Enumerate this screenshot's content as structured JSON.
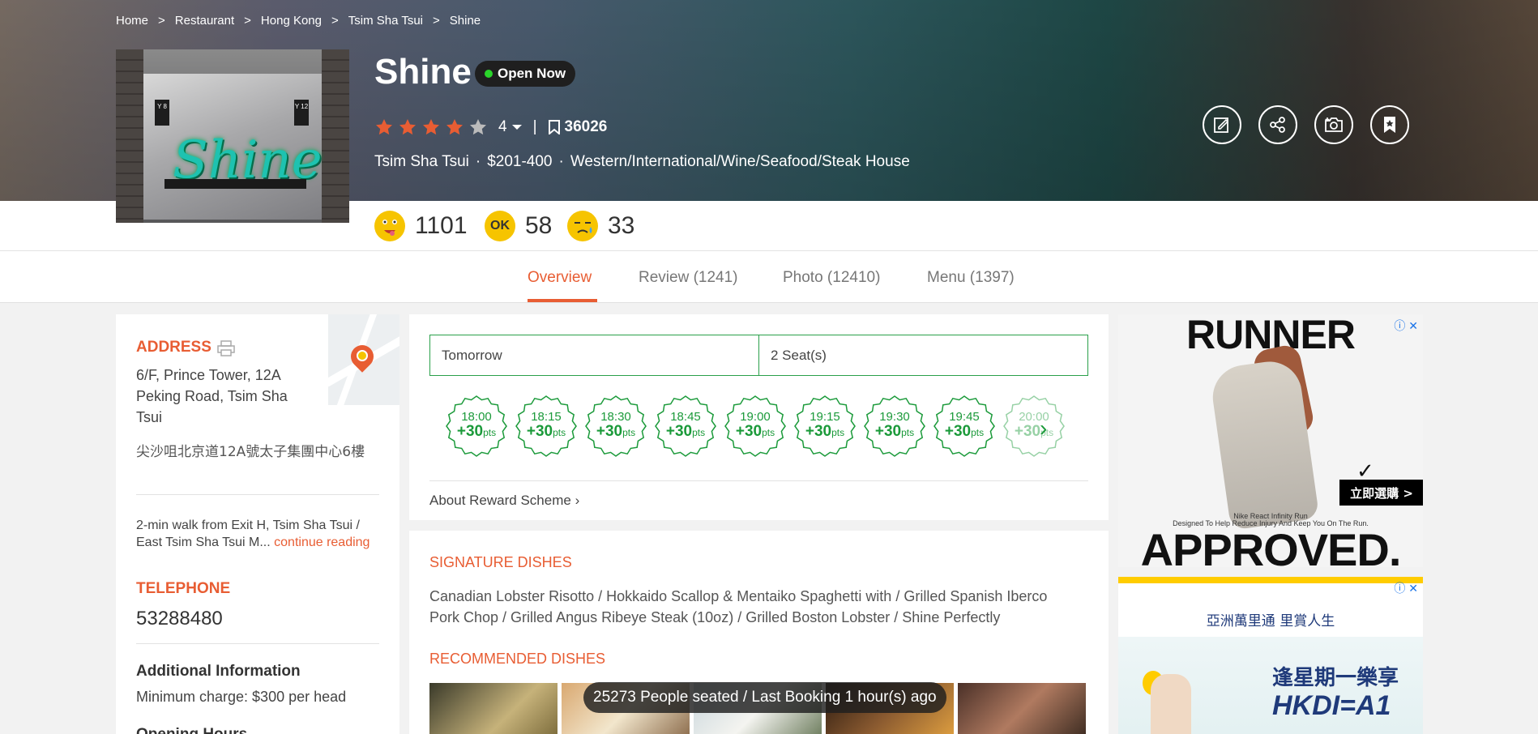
{
  "breadcrumb": [
    "Home",
    "Restaurant",
    "Hong Kong",
    "Tsim Sha Tsui",
    "Shine"
  ],
  "restaurant": {
    "name": "Shine",
    "status": "Open Now",
    "rating_stars": 4,
    "rating_display": "4",
    "bookmarks": "36026",
    "district": "Tsim Sha Tsui",
    "price": "$201-400",
    "cuisine": "Western/International/Wine/Seafood/Steak House",
    "thumb_sign": "Shine",
    "thumb_tag_left": "Y 8",
    "thumb_tag_right": "Y 12"
  },
  "reactions": {
    "smile": "1101",
    "ok": "58",
    "cry": "33",
    "ok_face": "OK"
  },
  "tabs": [
    {
      "label": "Overview",
      "active": true
    },
    {
      "label": "Review (1241)",
      "active": false
    },
    {
      "label": "Photo (12410)",
      "active": false
    },
    {
      "label": "Menu (1397)",
      "active": false
    }
  ],
  "sidebar": {
    "address_label": "ADDRESS",
    "address_en": "6/F, Prince Tower, 12A Peking Road, Tsim Sha Tsui",
    "address_zh": "尖沙咀北京道12A號太子集團中心6樓",
    "directions": "2-min walk from Exit H, Tsim Sha Tsui / East Tsim Sha Tsui M...",
    "continue": "continue reading",
    "telephone_label": "TELEPHONE",
    "telephone": "53288480",
    "additional_label": "Additional Information",
    "additional_text": "Minimum charge: $300 per head",
    "opening_label": "Opening Hours"
  },
  "booking": {
    "date": "Tomorrow",
    "seats": "2 Seat(s)",
    "slots": [
      {
        "time": "18:00",
        "pts": "+30",
        "unit": "pts"
      },
      {
        "time": "18:15",
        "pts": "+30",
        "unit": "pts"
      },
      {
        "time": "18:30",
        "pts": "+30",
        "unit": "pts"
      },
      {
        "time": "18:45",
        "pts": "+30",
        "unit": "pts"
      },
      {
        "time": "19:00",
        "pts": "+30",
        "unit": "pts"
      },
      {
        "time": "19:15",
        "pts": "+30",
        "unit": "pts"
      },
      {
        "time": "19:30",
        "pts": "+30",
        "unit": "pts"
      },
      {
        "time": "19:45",
        "pts": "+30",
        "unit": "pts"
      },
      {
        "time": "20:00",
        "pts": "+30",
        "unit": "pts"
      }
    ],
    "reward": "About Reward Scheme"
  },
  "signature": {
    "label": "SIGNATURE DISHES",
    "text": "Canadian Lobster Risotto / Hokkaido Scallop & Mentaiko Spaghetti with / Grilled Spanish Iberco Pork Chop / Grilled Angus Ribeye Steak (10oz) / Grilled Boston Lobster / Shine Perfectly",
    "recommended_label": "RECOMMENDED DISHES",
    "seated": "25273 People seated / Last Booking 1 hour(s) ago"
  },
  "ads": {
    "ad1_top": "RUNNER",
    "ad1_bottom": "APPROVED.",
    "ad1_cta": "立即選購 >",
    "ad1_line1": "Nike React Infinity Run",
    "ad1_line2": "Designed To Help Reduce Injury And Keep You On The Run.",
    "ad2_brand": "亞洲萬里通  里賞人生",
    "ad2_promo": "逢星期一樂享",
    "ad2_hkdi": "HKDI=A1",
    "choice_icon": "ⓘ ✕"
  },
  "colors": {
    "accent": "#e85d33",
    "green": "#1b9a3a",
    "star_on": "#e85d33",
    "star_off": "#bbbbbb"
  }
}
